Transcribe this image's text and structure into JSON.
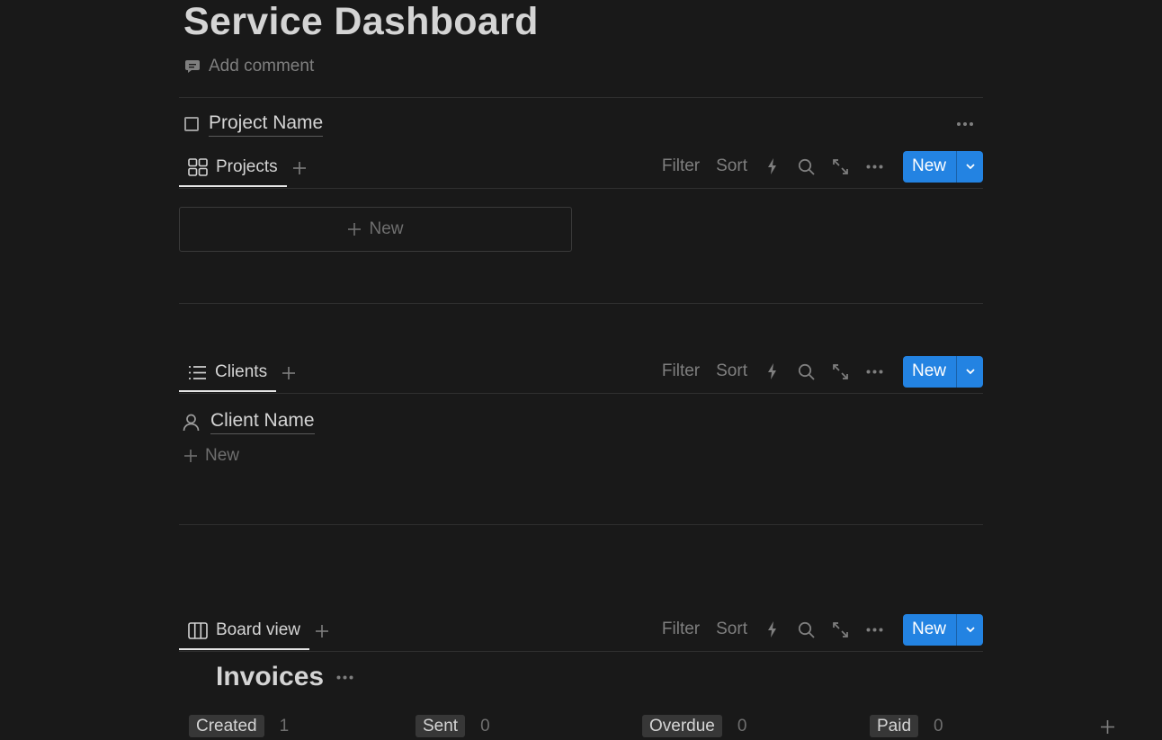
{
  "page": {
    "title": "Service Dashboard",
    "add_comment": "Add comment"
  },
  "project_name": "Project Name",
  "views": {
    "projects": {
      "tab_label": "Projects",
      "new_card": "New"
    },
    "clients": {
      "tab_label": "Clients",
      "row_title": "Client Name",
      "new_row": "New"
    },
    "board": {
      "tab_label": "Board view",
      "group_title": "Invoices"
    }
  },
  "toolbar": {
    "filter": "Filter",
    "sort": "Sort",
    "new": "New"
  },
  "board_columns": [
    {
      "label": "Created",
      "count": "1"
    },
    {
      "label": "Sent",
      "count": "0"
    },
    {
      "label": "Overdue",
      "count": "0"
    },
    {
      "label": "Paid",
      "count": "0"
    }
  ],
  "colors": {
    "accent": "#2383e2",
    "background": "#191919"
  }
}
